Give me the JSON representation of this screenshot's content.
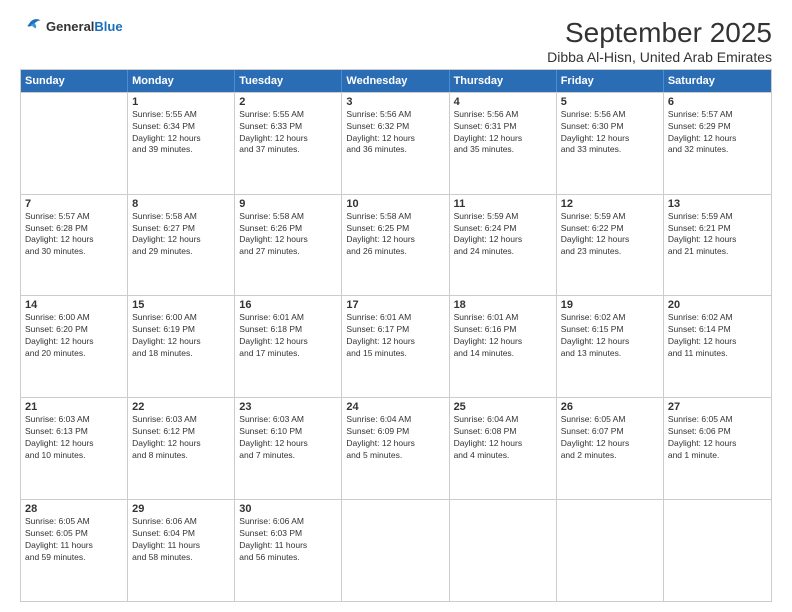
{
  "header": {
    "logo": {
      "general": "General",
      "blue": "Blue"
    },
    "title": "September 2025",
    "subtitle": "Dibba Al-Hisn, United Arab Emirates"
  },
  "calendar": {
    "days": [
      "Sunday",
      "Monday",
      "Tuesday",
      "Wednesday",
      "Thursday",
      "Friday",
      "Saturday"
    ],
    "rows": [
      [
        {
          "day": "",
          "info": ""
        },
        {
          "day": "1",
          "info": "Sunrise: 5:55 AM\nSunset: 6:34 PM\nDaylight: 12 hours\nand 39 minutes."
        },
        {
          "day": "2",
          "info": "Sunrise: 5:55 AM\nSunset: 6:33 PM\nDaylight: 12 hours\nand 37 minutes."
        },
        {
          "day": "3",
          "info": "Sunrise: 5:56 AM\nSunset: 6:32 PM\nDaylight: 12 hours\nand 36 minutes."
        },
        {
          "day": "4",
          "info": "Sunrise: 5:56 AM\nSunset: 6:31 PM\nDaylight: 12 hours\nand 35 minutes."
        },
        {
          "day": "5",
          "info": "Sunrise: 5:56 AM\nSunset: 6:30 PM\nDaylight: 12 hours\nand 33 minutes."
        },
        {
          "day": "6",
          "info": "Sunrise: 5:57 AM\nSunset: 6:29 PM\nDaylight: 12 hours\nand 32 minutes."
        }
      ],
      [
        {
          "day": "7",
          "info": "Sunrise: 5:57 AM\nSunset: 6:28 PM\nDaylight: 12 hours\nand 30 minutes."
        },
        {
          "day": "8",
          "info": "Sunrise: 5:58 AM\nSunset: 6:27 PM\nDaylight: 12 hours\nand 29 minutes."
        },
        {
          "day": "9",
          "info": "Sunrise: 5:58 AM\nSunset: 6:26 PM\nDaylight: 12 hours\nand 27 minutes."
        },
        {
          "day": "10",
          "info": "Sunrise: 5:58 AM\nSunset: 6:25 PM\nDaylight: 12 hours\nand 26 minutes."
        },
        {
          "day": "11",
          "info": "Sunrise: 5:59 AM\nSunset: 6:24 PM\nDaylight: 12 hours\nand 24 minutes."
        },
        {
          "day": "12",
          "info": "Sunrise: 5:59 AM\nSunset: 6:22 PM\nDaylight: 12 hours\nand 23 minutes."
        },
        {
          "day": "13",
          "info": "Sunrise: 5:59 AM\nSunset: 6:21 PM\nDaylight: 12 hours\nand 21 minutes."
        }
      ],
      [
        {
          "day": "14",
          "info": "Sunrise: 6:00 AM\nSunset: 6:20 PM\nDaylight: 12 hours\nand 20 minutes."
        },
        {
          "day": "15",
          "info": "Sunrise: 6:00 AM\nSunset: 6:19 PM\nDaylight: 12 hours\nand 18 minutes."
        },
        {
          "day": "16",
          "info": "Sunrise: 6:01 AM\nSunset: 6:18 PM\nDaylight: 12 hours\nand 17 minutes."
        },
        {
          "day": "17",
          "info": "Sunrise: 6:01 AM\nSunset: 6:17 PM\nDaylight: 12 hours\nand 15 minutes."
        },
        {
          "day": "18",
          "info": "Sunrise: 6:01 AM\nSunset: 6:16 PM\nDaylight: 12 hours\nand 14 minutes."
        },
        {
          "day": "19",
          "info": "Sunrise: 6:02 AM\nSunset: 6:15 PM\nDaylight: 12 hours\nand 13 minutes."
        },
        {
          "day": "20",
          "info": "Sunrise: 6:02 AM\nSunset: 6:14 PM\nDaylight: 12 hours\nand 11 minutes."
        }
      ],
      [
        {
          "day": "21",
          "info": "Sunrise: 6:03 AM\nSunset: 6:13 PM\nDaylight: 12 hours\nand 10 minutes."
        },
        {
          "day": "22",
          "info": "Sunrise: 6:03 AM\nSunset: 6:12 PM\nDaylight: 12 hours\nand 8 minutes."
        },
        {
          "day": "23",
          "info": "Sunrise: 6:03 AM\nSunset: 6:10 PM\nDaylight: 12 hours\nand 7 minutes."
        },
        {
          "day": "24",
          "info": "Sunrise: 6:04 AM\nSunset: 6:09 PM\nDaylight: 12 hours\nand 5 minutes."
        },
        {
          "day": "25",
          "info": "Sunrise: 6:04 AM\nSunset: 6:08 PM\nDaylight: 12 hours\nand 4 minutes."
        },
        {
          "day": "26",
          "info": "Sunrise: 6:05 AM\nSunset: 6:07 PM\nDaylight: 12 hours\nand 2 minutes."
        },
        {
          "day": "27",
          "info": "Sunrise: 6:05 AM\nSunset: 6:06 PM\nDaylight: 12 hours\nand 1 minute."
        }
      ],
      [
        {
          "day": "28",
          "info": "Sunrise: 6:05 AM\nSunset: 6:05 PM\nDaylight: 11 hours\nand 59 minutes."
        },
        {
          "day": "29",
          "info": "Sunrise: 6:06 AM\nSunset: 6:04 PM\nDaylight: 11 hours\nand 58 minutes."
        },
        {
          "day": "30",
          "info": "Sunrise: 6:06 AM\nSunset: 6:03 PM\nDaylight: 11 hours\nand 56 minutes."
        },
        {
          "day": "",
          "info": ""
        },
        {
          "day": "",
          "info": ""
        },
        {
          "day": "",
          "info": ""
        },
        {
          "day": "",
          "info": ""
        }
      ]
    ]
  }
}
